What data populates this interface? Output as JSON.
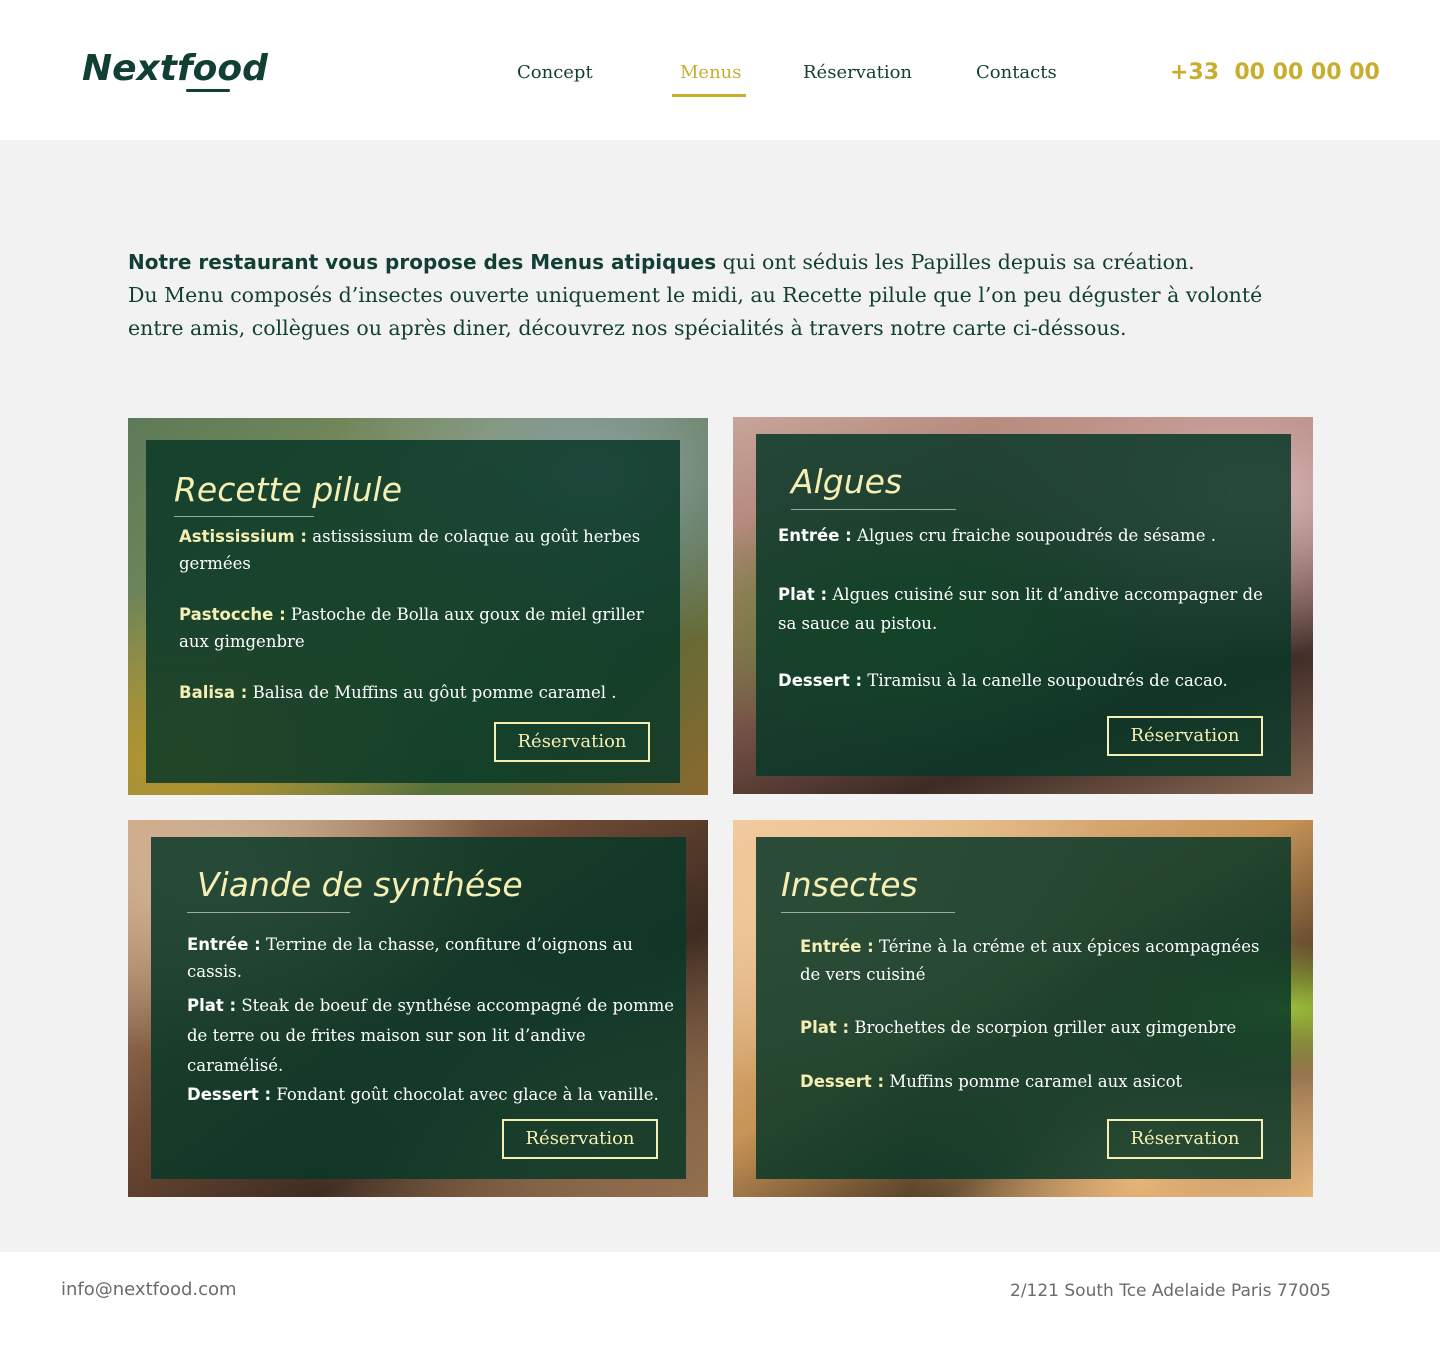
{
  "header": {
    "logo": "Nextfood",
    "nav": [
      "Concept",
      "Menus",
      "Réservation",
      "Contacts"
    ],
    "phone": "+33  00 00 00 00"
  },
  "intro": {
    "bold": "Notre restaurant vous propose des Menus atipiques",
    "rest": " qui ont séduis  les Papilles depuis sa création.",
    "line2": "Du Menu composés d’insectes ouverte uniquement le midi, au Recette pilule que l’on peu déguster à volonté entre amis, collègues ou après diner, découvrez nos spécialités à travers notre carte ci-déssous."
  },
  "cards": [
    {
      "title": "Recette pilule",
      "items": [
        {
          "label": "Astississium :",
          "text": " astississium de colaque  au goût herbes germées"
        },
        {
          "label": "Pastocche :",
          "text": " Pastoche  de Bolla aux goux de miel griller aux gimgenbre"
        },
        {
          "label": "Balisa :",
          "text": " Balisa de Muffins au gôut pomme caramel ."
        }
      ],
      "button": "Réservation"
    },
    {
      "title": "Algues",
      "items": [
        {
          "label": "Entrée :",
          "text": " Algues cru fraiche soupoudrés de sésame ."
        },
        {
          "label": "Plat :",
          "text": " Algues cuisiné sur son lit d’andive accompagner de sa sauce au pistou."
        },
        {
          "label": "Dessert :",
          "text": " Tiramisu à la canelle soupoudrés de cacao."
        }
      ],
      "button": "Réservation"
    },
    {
      "title": "Viande de synthése",
      "items": [
        {
          "label": "Entrée :",
          "text": " Terrine de la chasse, confiture d’oignons au cassis."
        },
        {
          "label": "Plat :",
          "text": " Steak de boeuf de synthése accompagné de pomme de terre ou de frites maison sur son lit d’andive caramélisé."
        },
        {
          "label": "Dessert :",
          "text": " Fondant goût chocolat avec glace à la vanille."
        }
      ],
      "button": "Réservation"
    },
    {
      "title": "Insectes",
      "items": [
        {
          "label": "Entrée :",
          "text": " Térine à la créme et aux épices acompagnées de vers cuisiné"
        },
        {
          "label": "Plat :",
          "text": " Brochettes de scorpion griller aux gimgenbre"
        },
        {
          "label": "Dessert :",
          "text": " Muffins pomme caramel aux asicot"
        }
      ],
      "button": "Réservation"
    }
  ],
  "footer": {
    "email": "info@nextfood.com",
    "address": "2/121 South Tce Adelaide Paris 77005"
  },
  "colors": {
    "brand_green": "#123f33",
    "accent_gold": "#c9ad2f",
    "card_title": "#f6efb4"
  }
}
